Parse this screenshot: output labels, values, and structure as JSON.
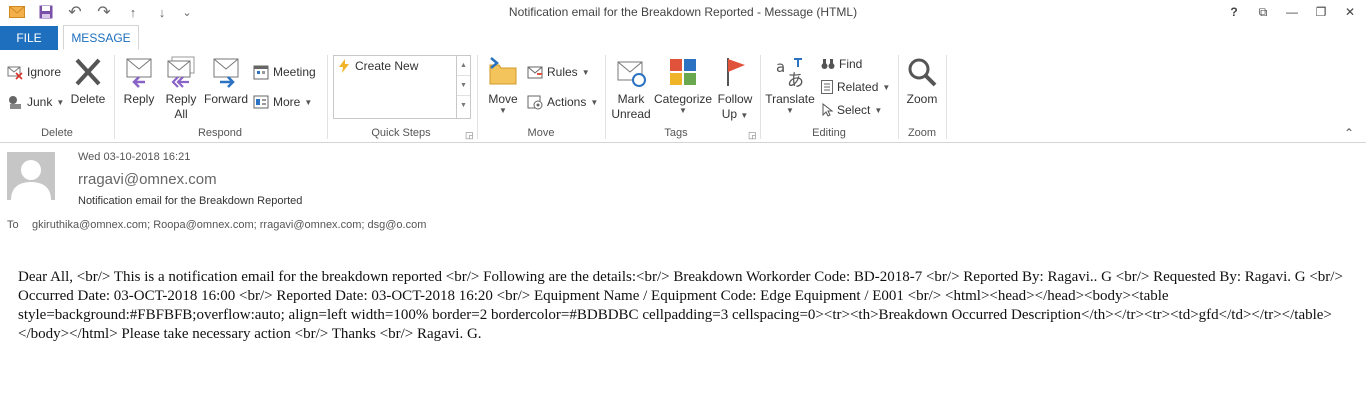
{
  "window": {
    "title": "Notification email for the Breakdown Reported - Message (HTML)",
    "help": "?",
    "ribbon_display": "⧉",
    "minimize": "—",
    "restore": "❐",
    "close": "✕"
  },
  "qat": {
    "mail_icon": "mail-icon",
    "save_icon": "save-icon",
    "undo_icon": "undo-icon",
    "redo_icon": "redo-icon",
    "up_icon": "↑",
    "down_icon": "↓",
    "customize_icon": "⌄",
    "undo_glyph": "↶",
    "redo_glyph": "↷"
  },
  "tabs": {
    "file": "FILE",
    "message": "MESSAGE"
  },
  "ribbon": {
    "delete_group": {
      "label": "Delete",
      "ignore": "Ignore",
      "junk": "Junk",
      "delete": "Delete"
    },
    "respond_group": {
      "label": "Respond",
      "reply": "Reply",
      "reply_all_1": "Reply",
      "reply_all_2": "All",
      "forward": "Forward",
      "meeting": "Meeting",
      "more": "More"
    },
    "quick_steps_group": {
      "label": "Quick Steps",
      "create_new": "Create New"
    },
    "move_group": {
      "label": "Move",
      "move": "Move",
      "rules": "Rules",
      "actions": "Actions"
    },
    "tags_group": {
      "label": "Tags",
      "mark_unread_1": "Mark",
      "mark_unread_2": "Unread",
      "categorize": "Categorize",
      "follow_up_1": "Follow",
      "follow_up_2": "Up"
    },
    "editing_group": {
      "label": "Editing",
      "translate": "Translate",
      "find": "Find",
      "related": "Related",
      "select": "Select"
    },
    "zoom_group": {
      "label": "Zoom",
      "zoom": "Zoom"
    },
    "collapse_icon": "⌃"
  },
  "message": {
    "date": "Wed 03-10-2018 16:21",
    "from": "rragavi@omnex.com",
    "subject": "Notification email for the Breakdown Reported",
    "to_label": "To",
    "to": "gkiruthika@omnex.com; Roopa@omnex.com; rragavi@omnex.com; dsg@o.com",
    "body": "Dear All, <br/> This is a notification email for the breakdown reported <br/> Following are the details:<br/> Breakdown Workorder Code: BD-2018-7 <br/> Reported By: Ragavi.. G <br/> Requested By: Ragavi. G <br/> Occurred Date: 03-OCT-2018 16:00 <br/> Reported Date: 03-OCT-2018 16:20 <br/> Equipment Name / Equipment Code: Edge Equipment / E001 <br/> <html><head></head><body><table style=background:#FBFBFB;overflow:auto; align=left width=100% border=2 bordercolor=#BDBDBC cellpadding=3 cellspacing=0><tr><th>Breakdown Occurred Description</th></tr><tr><td>gfd</td></tr></table></body></html> Please take necessary action <br/> Thanks <br/> Ragavi. G."
  },
  "colors": {
    "accent": "#1e6fbd",
    "reply_arrow": "#8a63c7",
    "forward_arrow": "#2b73c2",
    "follow_flag": "#e0523a"
  }
}
